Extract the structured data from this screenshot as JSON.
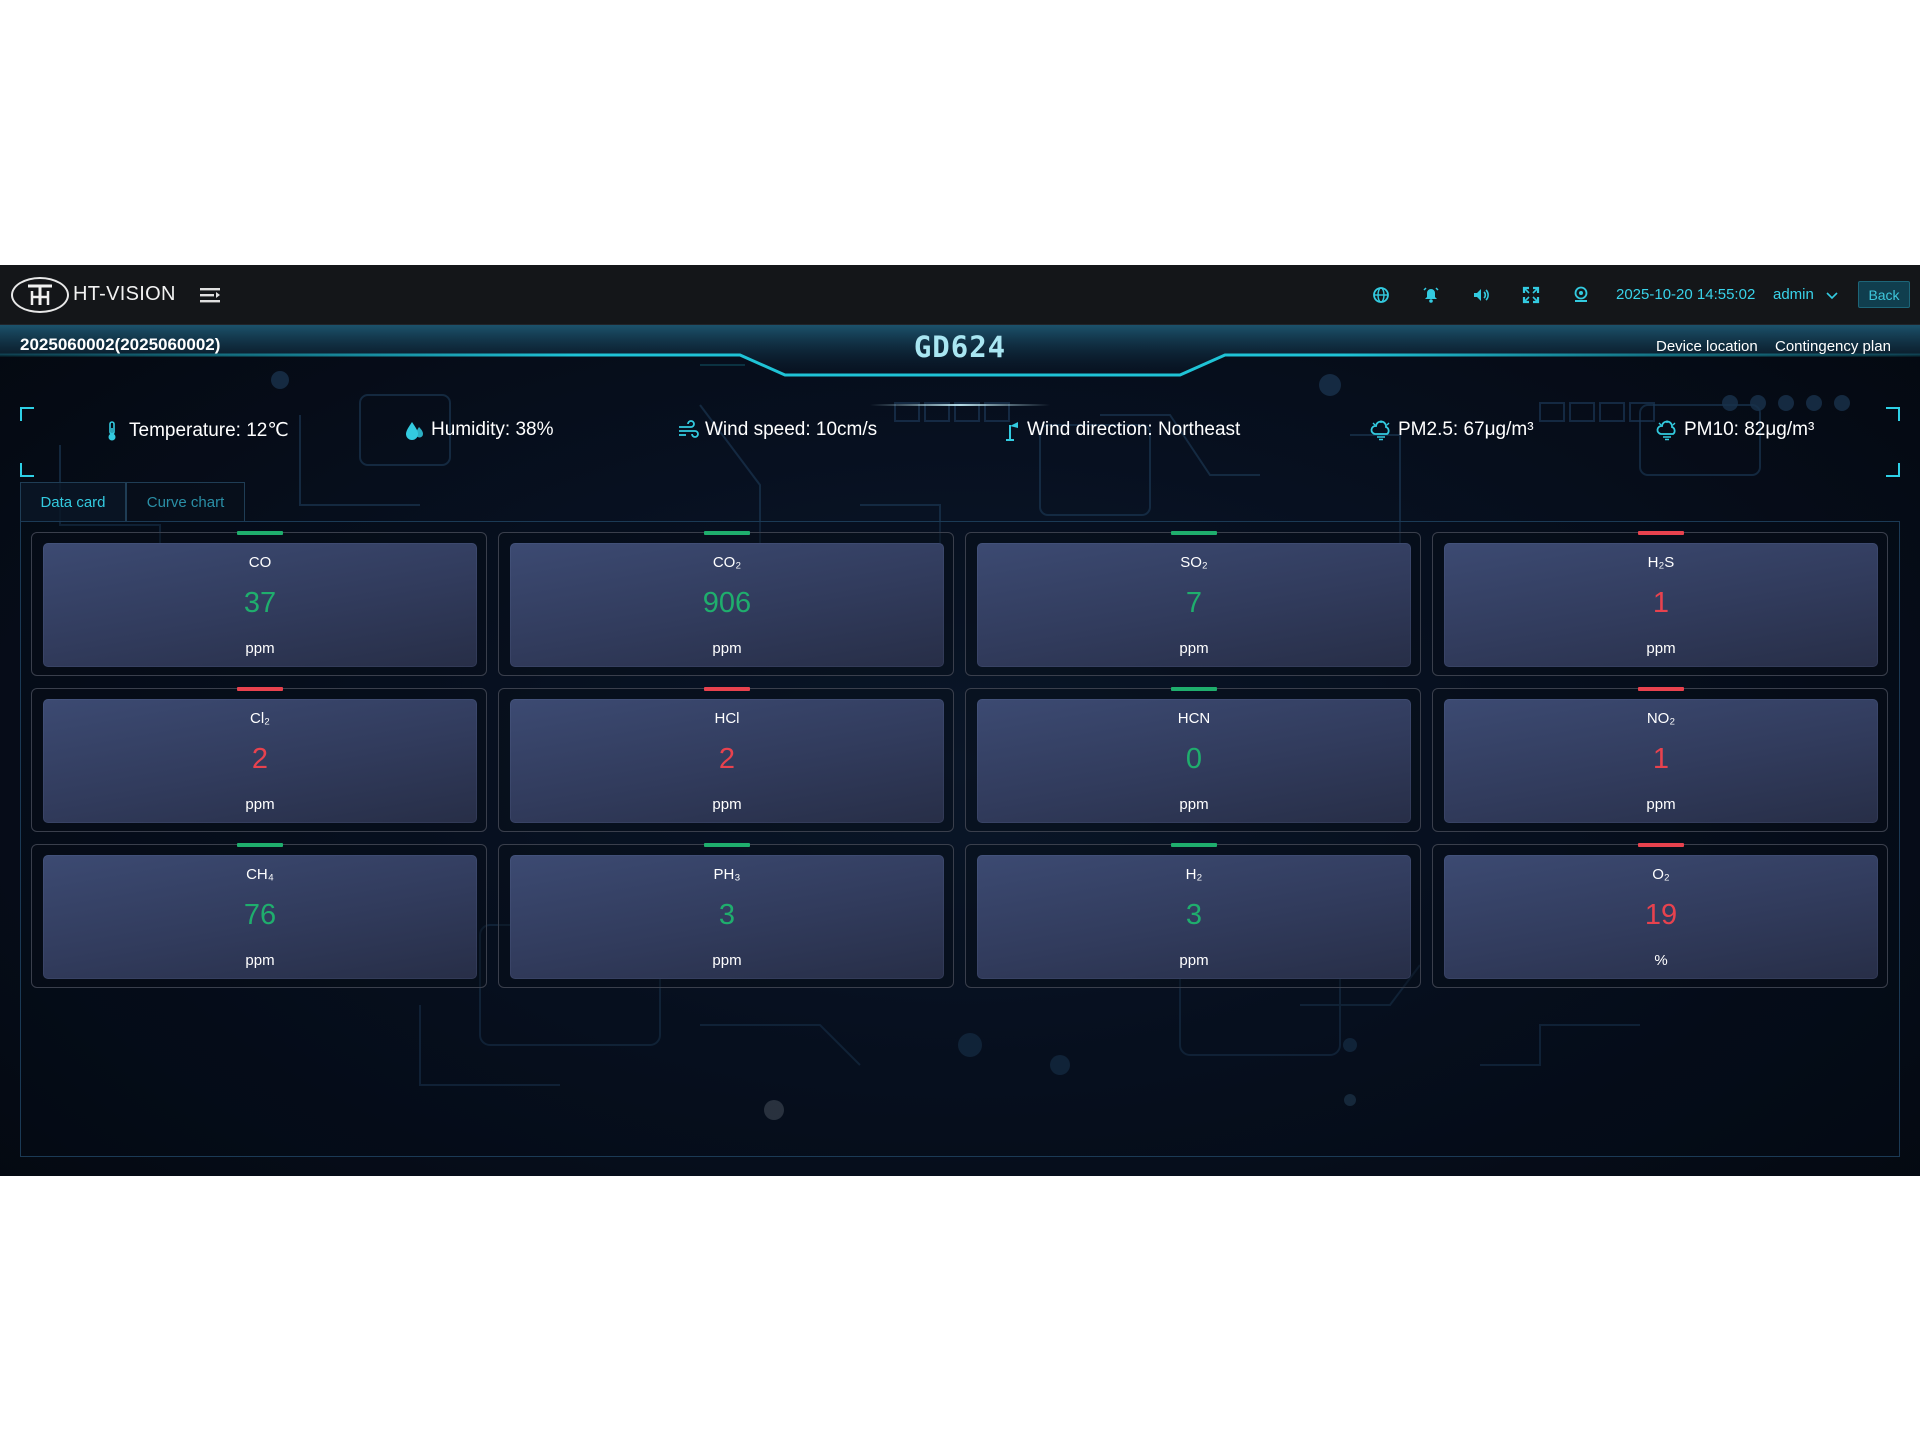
{
  "app": {
    "logo_mark": "HT",
    "brand": "HT-VISION"
  },
  "topbar": {
    "icons": [
      "globe-icon",
      "bell-icon",
      "speaker-icon",
      "fullscreen-icon",
      "location-icon"
    ],
    "datetime": "2025-10-20 14:55:02",
    "user": "admin",
    "back_label": "Back"
  },
  "header": {
    "device_id": "2025060002(2025060002)",
    "device_title": "GD624",
    "links": {
      "location": "Device location",
      "plan": "Contingency plan"
    }
  },
  "env": {
    "temperature": "Temperature: 12℃",
    "humidity": "Humidity: 38%",
    "wind_speed": "Wind speed: 10cm/s",
    "wind_direction": "Wind direction: Northeast",
    "pm25": "PM2.5: 67μg/m³",
    "pm10": "PM10: 82μg/m³"
  },
  "tabs": {
    "data_card": "Data card",
    "curve_chart": "Curve chart"
  },
  "colors": {
    "normal": "#1fae6d",
    "alarm": "#e8424e",
    "accent": "#33cbe0"
  },
  "cards": [
    {
      "name": "CO",
      "value": "37",
      "unit": "ppm",
      "status": "normal"
    },
    {
      "name": "CO₂",
      "value": "906",
      "unit": "ppm",
      "status": "normal"
    },
    {
      "name": "SO₂",
      "value": "7",
      "unit": "ppm",
      "status": "normal"
    },
    {
      "name": "H₂S",
      "value": "1",
      "unit": "ppm",
      "status": "alarm"
    },
    {
      "name": "Cl₂",
      "value": "2",
      "unit": "ppm",
      "status": "alarm"
    },
    {
      "name": "HCl",
      "value": "2",
      "unit": "ppm",
      "status": "alarm"
    },
    {
      "name": "HCN",
      "value": "0",
      "unit": "ppm",
      "status": "normal"
    },
    {
      "name": "NO₂",
      "value": "1",
      "unit": "ppm",
      "status": "alarm"
    },
    {
      "name": "CH₄",
      "value": "76",
      "unit": "ppm",
      "status": "normal"
    },
    {
      "name": "PH₃",
      "value": "3",
      "unit": "ppm",
      "status": "normal"
    },
    {
      "name": "H₂",
      "value": "3",
      "unit": "ppm",
      "status": "normal"
    },
    {
      "name": "O₂",
      "value": "19",
      "unit": "%",
      "status": "alarm"
    }
  ]
}
